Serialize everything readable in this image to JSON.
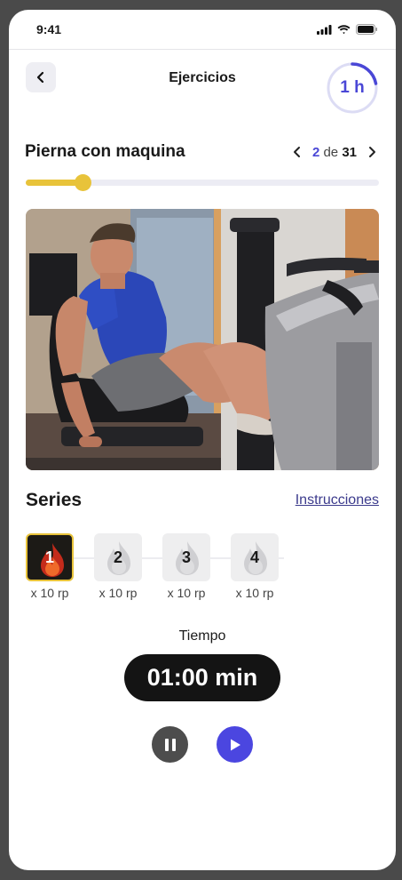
{
  "status_bar": {
    "time": "9:41"
  },
  "header": {
    "title": "Ejercicios",
    "duration_badge": "1 h",
    "duration_progress": 0.22,
    "accent_color": "#4a47d6"
  },
  "exercise": {
    "name": "Pierna con maquina",
    "current": "2",
    "of_label": "de",
    "total": "31",
    "progress_fraction": 0.16,
    "progress_color": "#e8c33a"
  },
  "series": {
    "title": "Series",
    "instructions_link": "Instrucciones",
    "sets": [
      {
        "number": "1",
        "reps": "x 10 rp",
        "active": true
      },
      {
        "number": "2",
        "reps": "x 10 rp",
        "active": false
      },
      {
        "number": "3",
        "reps": "x 10 rp",
        "active": false
      },
      {
        "number": "4",
        "reps": "x 10 rp",
        "active": false
      }
    ]
  },
  "timer": {
    "label": "Tiempo",
    "value": "01:00 min"
  },
  "controls": {
    "pause_icon": "pause-icon",
    "play_icon": "play-icon",
    "play_color": "#4b46e0"
  }
}
